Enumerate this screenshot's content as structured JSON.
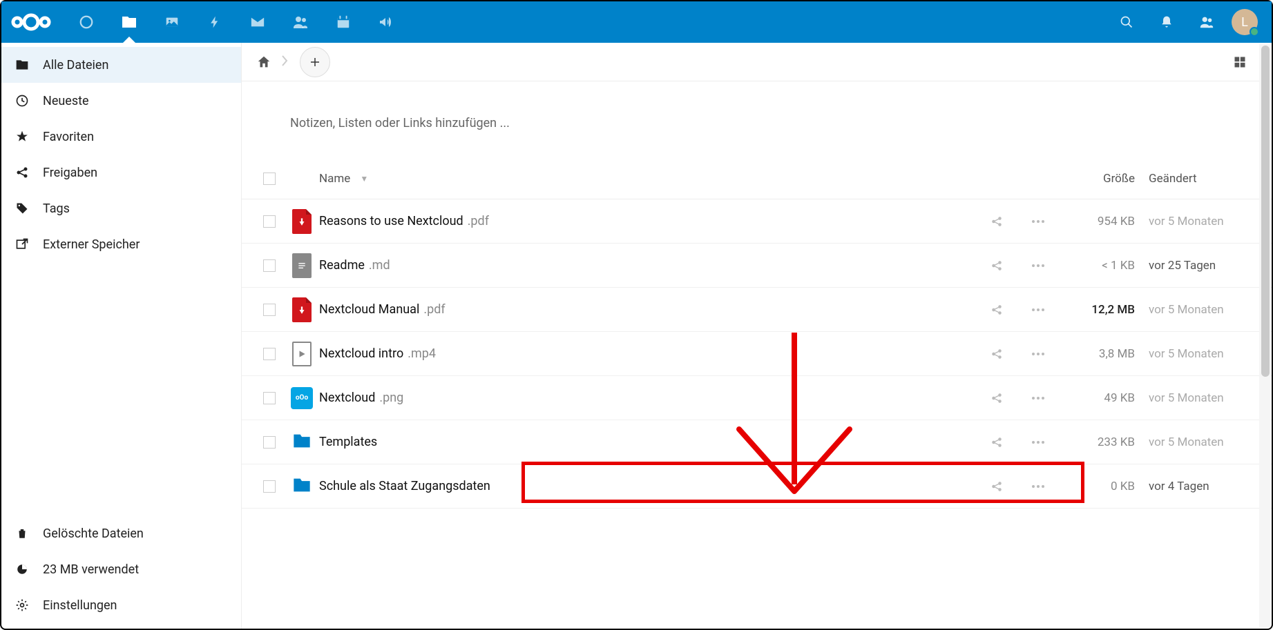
{
  "avatar_letter": "L",
  "sidebar": {
    "items": [
      {
        "label": "Alle Dateien",
        "active": true,
        "icon": "folder"
      },
      {
        "label": "Neueste",
        "icon": "clock"
      },
      {
        "label": "Favoriten",
        "icon": "star"
      },
      {
        "label": "Freigaben",
        "icon": "share"
      },
      {
        "label": "Tags",
        "icon": "tag"
      },
      {
        "label": "Externer Speicher",
        "icon": "external"
      }
    ],
    "footer": {
      "deleted": "Gelöschte Dateien",
      "quota": "23 MB verwendet",
      "settings": "Einstellungen"
    }
  },
  "notes_placeholder": "Notizen, Listen oder Links hinzufügen ...",
  "table": {
    "header": {
      "name": "Name",
      "size": "Größe",
      "modified": "Geändert"
    },
    "rows": [
      {
        "name": "Reasons to use Nextcloud",
        "ext": ".pdf",
        "size": "954 KB",
        "date": "vor 5 Monaten",
        "icon": "pdf",
        "datelight": true
      },
      {
        "name": "Readme",
        "ext": ".md",
        "size": "< 1 KB",
        "date": "vor 25 Tagen",
        "icon": "doc"
      },
      {
        "name": "Nextcloud Manual",
        "ext": ".pdf",
        "size": "12,2 MB",
        "date": "vor 5 Monaten",
        "icon": "pdf",
        "sizebold": true,
        "datelight": true
      },
      {
        "name": "Nextcloud intro",
        "ext": ".mp4",
        "size": "3,8 MB",
        "date": "vor 5 Monaten",
        "icon": "video",
        "datelight": true
      },
      {
        "name": "Nextcloud",
        "ext": ".png",
        "size": "49 KB",
        "date": "vor 5 Monaten",
        "icon": "img",
        "datelight": true
      },
      {
        "name": "Templates",
        "ext": "",
        "size": "233 KB",
        "date": "vor 5 Monaten",
        "icon": "folder",
        "datelight": true
      },
      {
        "name": "Schule als Staat Zugangsdaten",
        "ext": "",
        "size": "0 KB",
        "date": "vor 4 Tagen",
        "icon": "folder",
        "highlight": true
      }
    ]
  }
}
